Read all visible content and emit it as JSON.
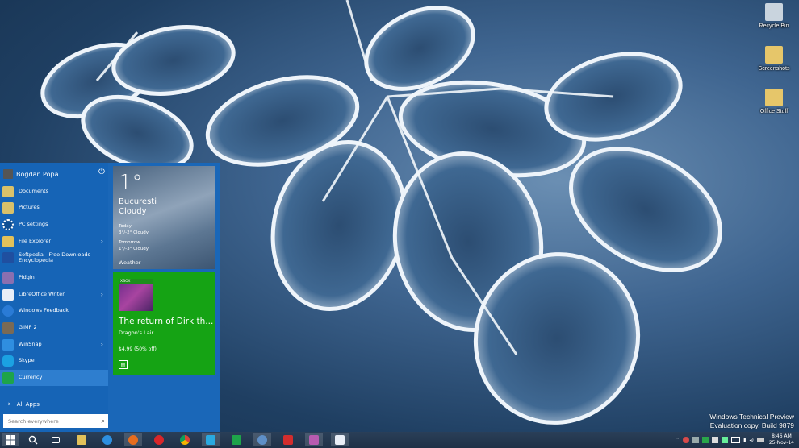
{
  "desktop": {
    "icons": [
      {
        "label": "Recycle Bin",
        "color": "#c9d4de"
      },
      {
        "label": "Screenshots",
        "color": "#e6c66a"
      },
      {
        "label": "Office Stuff",
        "color": "#e6c66a"
      }
    ],
    "watermark": {
      "line1": "Windows Technical Preview",
      "line2": "Evaluation copy. Build 9879"
    }
  },
  "start_menu": {
    "user": {
      "name": "Bogdan Popa",
      "power_icon": "power-icon"
    },
    "items": [
      {
        "label": "Documents",
        "icon": "documents-icon",
        "color": "#d9c16a"
      },
      {
        "label": "Pictures",
        "icon": "pictures-icon",
        "color": "#d9c16a"
      },
      {
        "label": "PC settings",
        "icon": "gear-icon",
        "color": "#1a67b8"
      },
      {
        "label": "File Explorer",
        "icon": "folder-icon",
        "color": "#e2c15a",
        "chevron": "›"
      },
      {
        "label": "Softpedia - Free Downloads Encyclopedia",
        "icon": "softpedia-icon",
        "color": "#1f4fa0"
      },
      {
        "label": "Pidgin",
        "icon": "pidgin-icon",
        "color": "#8a6fb0"
      },
      {
        "label": "LibreOffice Writer",
        "icon": "writer-icon",
        "color": "#e9eef7",
        "chevron": "›"
      },
      {
        "label": "Windows Feedback",
        "icon": "feedback-icon",
        "color": "#2a7bd6"
      },
      {
        "label": "GIMP 2",
        "icon": "gimp-icon",
        "color": "#7a6a55"
      },
      {
        "label": "WinSnap",
        "icon": "winsnap-icon",
        "color": "#2f8ee0",
        "chevron": "›"
      },
      {
        "label": "Skype",
        "icon": "skype-icon",
        "color": "#1ba1e2"
      },
      {
        "label": "Currency",
        "icon": "currency-icon",
        "color": "#1ea44a"
      }
    ],
    "all_apps": "All Apps",
    "search_placeholder": "Search everywhere"
  },
  "tiles": {
    "weather": {
      "temp": "1°",
      "city": "Bucuresti",
      "condition": "Cloudy",
      "today_label": "Today",
      "today_value": "3°/-2° Cloudy",
      "tomorrow_label": "Tomorrow",
      "tomorrow_value": "1°/-3° Cloudy",
      "name": "Weather"
    },
    "store": {
      "badge": "XBOX",
      "title": "The return of Dirk th...",
      "subtitle": "Dragon's Lair",
      "price": "$4.99 (50% off)"
    }
  },
  "taskbar": {
    "apps": [
      {
        "name": "start-button",
        "color": "#ffffff"
      },
      {
        "name": "search-icon",
        "color": "#ffffff"
      },
      {
        "name": "task-view-icon",
        "color": "#ffffff"
      },
      {
        "name": "file-explorer-icon",
        "color": "#e2c15a"
      },
      {
        "name": "internet-explorer-icon",
        "color": "#2d8fe0"
      },
      {
        "name": "firefox-icon",
        "color": "#e66d1f"
      },
      {
        "name": "opera-icon",
        "color": "#d8262a"
      },
      {
        "name": "chrome-icon",
        "color": "#4caf50"
      },
      {
        "name": "twitter-icon",
        "color": "#2aa9e0"
      },
      {
        "name": "store-icon",
        "color": "#1ea44a"
      },
      {
        "name": "thunderbird-icon",
        "color": "#5e8fc7"
      },
      {
        "name": "app-red-icon",
        "color": "#d32d2d"
      },
      {
        "name": "app-mixed-icon",
        "color": "#b75bb0"
      },
      {
        "name": "writer-icon",
        "color": "#e9eef7"
      }
    ],
    "clock_time": "8:46 AM",
    "clock_date": "25-Nov-14"
  }
}
